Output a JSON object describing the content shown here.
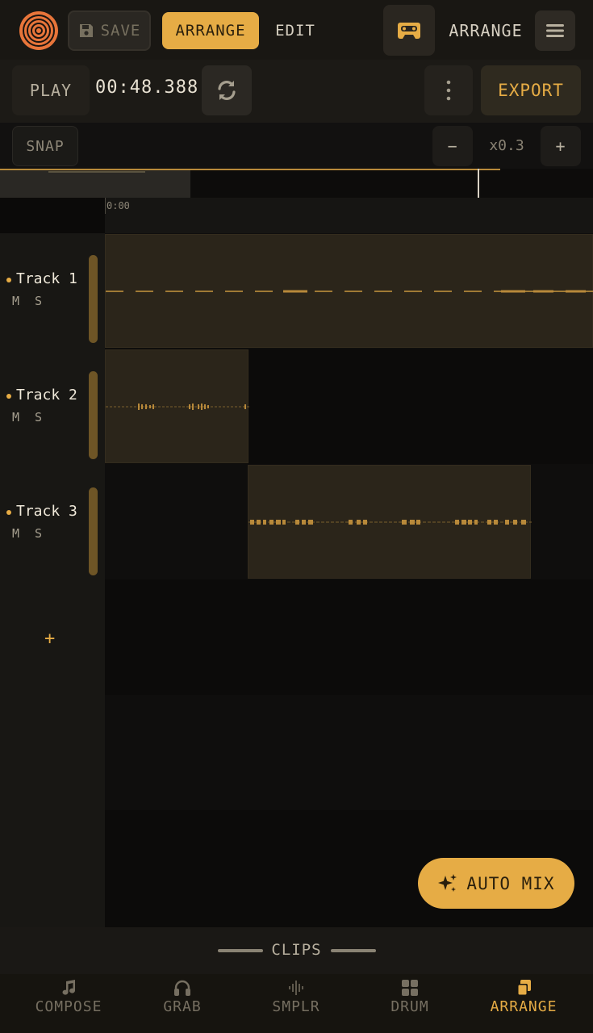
{
  "topbar": {
    "save_label": "SAVE",
    "tab_arrange": "ARRANGE",
    "tab_edit": "EDIT",
    "view_label": "ARRANGE",
    "icons": [
      "logo-icon",
      "save-icon",
      "cassette-icon",
      "hamburger-menu-icon"
    ]
  },
  "transport": {
    "play_label": "PLAY",
    "timecode": "00:48.388",
    "export_label": "EXPORT",
    "icons": [
      "loop-icon",
      "more-vertical-icon"
    ]
  },
  "snap": {
    "snap_label": "SNAP",
    "zoom_out": "−",
    "zoom_level": "x0.3",
    "zoom_in": "+"
  },
  "ruler": {
    "start": "0:00"
  },
  "tracks": [
    {
      "name": "Track 1",
      "mute": "M",
      "solo": "S"
    },
    {
      "name": "Track 2",
      "mute": "M",
      "solo": "S"
    },
    {
      "name": "Track 3",
      "mute": "M",
      "solo": "S"
    }
  ],
  "add_track": "+",
  "automix_label": "AUTO MIX",
  "clips_label": "CLIPS",
  "nav": [
    {
      "label": "COMPOSE",
      "icon": "music-note-icon"
    },
    {
      "label": "GRAB",
      "icon": "headphones-icon"
    },
    {
      "label": "SMPLR",
      "icon": "waveform-icon"
    },
    {
      "label": "DRUM",
      "icon": "grid-pads-icon"
    },
    {
      "label": "ARRANGE",
      "icon": "stacked-clips-icon",
      "active": true
    }
  ],
  "colors": {
    "accent": "#e6ac45",
    "background": "#0b0a09",
    "clip": "#2b251a"
  }
}
